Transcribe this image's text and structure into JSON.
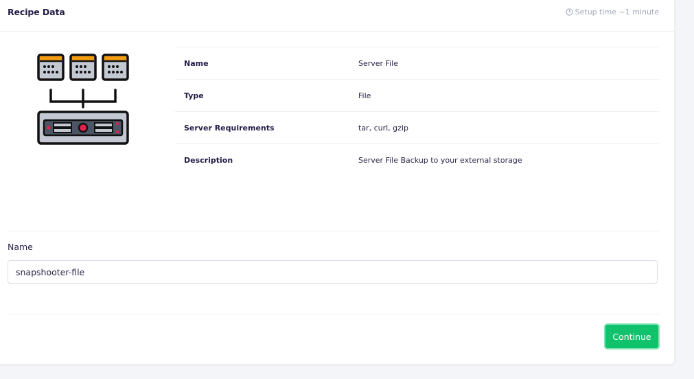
{
  "header": {
    "title": "Recipe Data",
    "setup_time": "Setup time ~1 minute",
    "setup_icon": "clock-icon"
  },
  "recipe": {
    "illustration": "server-file-icon",
    "rows": [
      {
        "key": "Name",
        "value": "Server File"
      },
      {
        "key": "Type",
        "value": "File"
      },
      {
        "key": "Server Requirements",
        "value": "tar, curl, gzip"
      },
      {
        "key": "Description",
        "value": "Server File Backup to your external storage"
      }
    ]
  },
  "form": {
    "name_label": "Name",
    "name_value": "snapshooter-file"
  },
  "actions": {
    "continue_label": "Continue"
  },
  "colors": {
    "accent": "#11c26d",
    "illustration_orange": "#f39c12",
    "illustration_red": "#e0224f",
    "illustration_gray": "#c3c8d2",
    "outline": "#111111"
  }
}
